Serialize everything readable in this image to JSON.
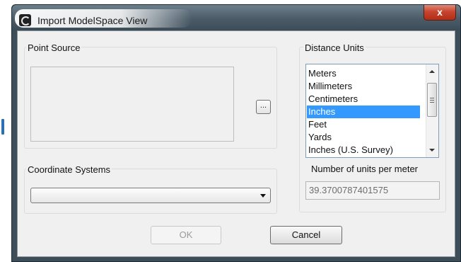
{
  "window": {
    "title": "Import ModelSpace View",
    "close_label": "x"
  },
  "point_source": {
    "label": "Point Source",
    "browse_label": "..."
  },
  "coordinate_systems": {
    "label": "Coordinate Systems",
    "selected": ""
  },
  "distance_units": {
    "label": "Distance Units",
    "items": [
      {
        "label": "Meters"
      },
      {
        "label": "Millimeters"
      },
      {
        "label": "Centimeters"
      },
      {
        "label": "Inches"
      },
      {
        "label": "Feet"
      },
      {
        "label": "Yards"
      },
      {
        "label": "Inches (U.S. Survey)"
      }
    ],
    "selected": "Inches"
  },
  "units_per_meter": {
    "label": "Number of units per meter",
    "value": "39.3700787401575"
  },
  "buttons": {
    "ok": "OK",
    "cancel": "Cancel"
  }
}
